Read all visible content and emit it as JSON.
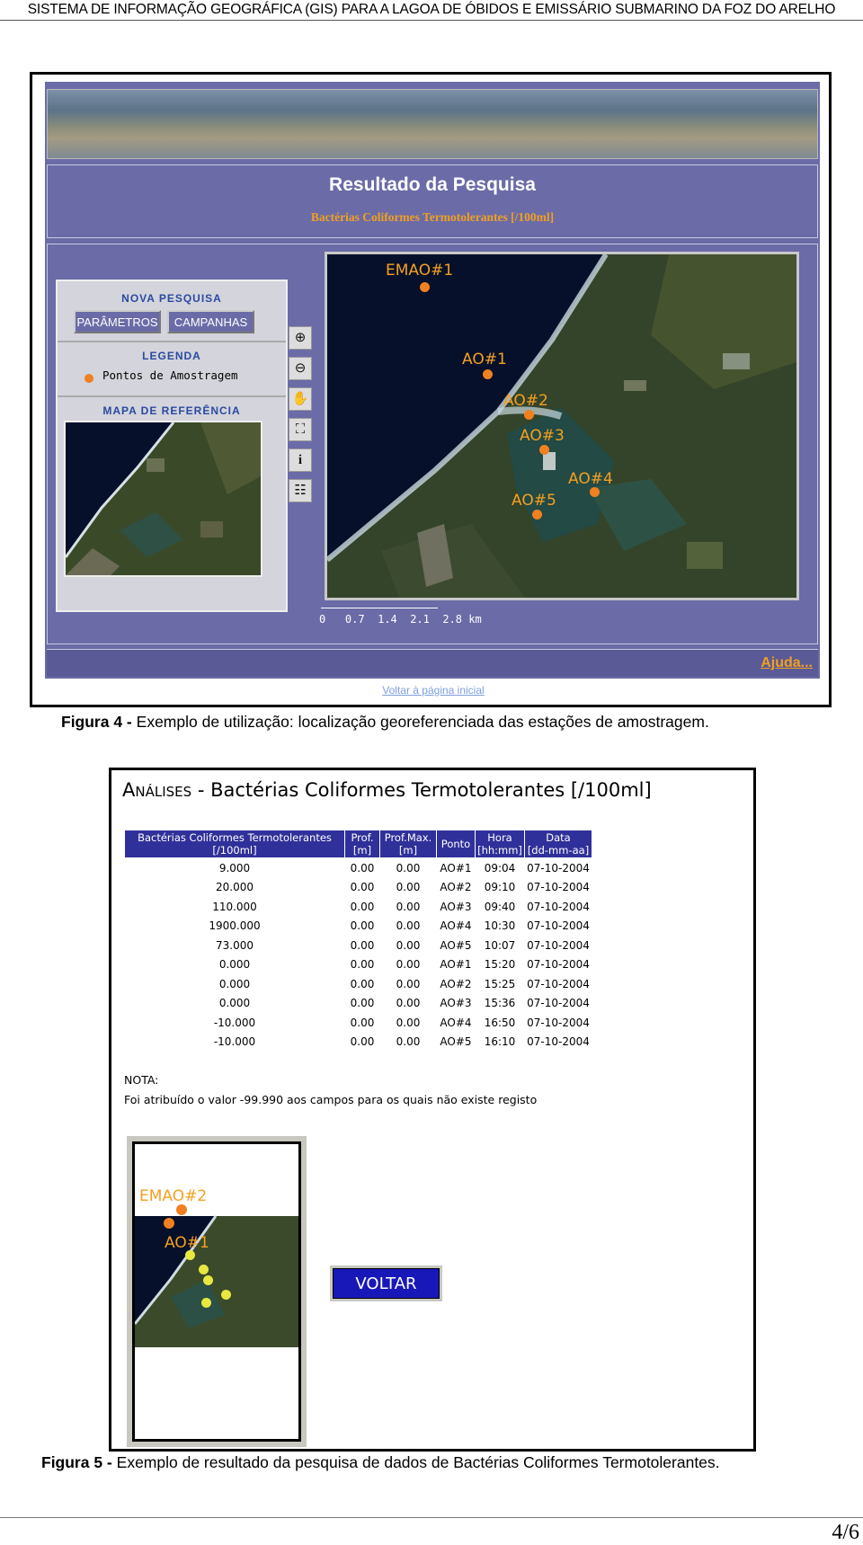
{
  "header": "SISTEMA DE INFORMAÇÃO GEOGRÁFICA (GIS) PARA A LAGOA DE ÓBIDOS E EMISSÁRIO SUBMARINO DA FOZ DO ARELHO",
  "fig4": {
    "result_title": "Resultado da Pesquisa",
    "result_subtitle": "Bactérias Coliformes Termotolerantes [/100ml]",
    "nova_pesquisa": "NOVA PESQUISA",
    "btn_parametros": "PARÂMETROS",
    "btn_campanhas": "CAMPANHAS",
    "legenda": "LEGENDA",
    "legend_item": "Pontos de Amostragem",
    "mapa_referencia": "MAPA DE REFERÊNCIA",
    "map_labels": [
      "EMAO#1",
      "AO#1",
      "AO#2",
      "AO#3",
      "AO#4",
      "AO#5"
    ],
    "scale_ticks": [
      "0",
      "0.7",
      "1.4",
      "2.1",
      "2.8"
    ],
    "scale_unit": "km",
    "ajuda": "Ajuda...",
    "voltar_link": "Voltar à página inicial",
    "caption_label": "Figura 4 -",
    "caption_text": "Exemplo de utilização: localização georeferenciada das estações de amostragem."
  },
  "fig5": {
    "title_a": "Análises",
    "title_b": " - Bactérias Coliformes Termotolerantes [/100ml]",
    "columns": [
      [
        "Bactérias Coliformes Termotolerantes",
        "[/100ml]"
      ],
      [
        "Prof.",
        "[m]"
      ],
      [
        "Prof.Max.",
        "[m]"
      ],
      [
        "Ponto",
        ""
      ],
      [
        "Hora",
        "[hh:mm]"
      ],
      [
        "Data",
        "[dd-mm-aa]"
      ]
    ],
    "rows": [
      [
        "9.000",
        "0.00",
        "0.00",
        "AO#1",
        "09:04",
        "07-10-2004"
      ],
      [
        "20.000",
        "0.00",
        "0.00",
        "AO#2",
        "09:10",
        "07-10-2004"
      ],
      [
        "110.000",
        "0.00",
        "0.00",
        "AO#3",
        "09:40",
        "07-10-2004"
      ],
      [
        "1900.000",
        "0.00",
        "0.00",
        "AO#4",
        "10:30",
        "07-10-2004"
      ],
      [
        "73.000",
        "0.00",
        "0.00",
        "AO#5",
        "10:07",
        "07-10-2004"
      ],
      [
        "0.000",
        "0.00",
        "0.00",
        "AO#1",
        "15:20",
        "07-10-2004"
      ],
      [
        "0.000",
        "0.00",
        "0.00",
        "AO#2",
        "15:25",
        "07-10-2004"
      ],
      [
        "0.000",
        "0.00",
        "0.00",
        "AO#3",
        "15:36",
        "07-10-2004"
      ],
      [
        "-10.000",
        "0.00",
        "0.00",
        "AO#4",
        "16:50",
        "07-10-2004"
      ],
      [
        "-10.000",
        "0.00",
        "0.00",
        "AO#5",
        "16:10",
        "07-10-2004"
      ]
    ],
    "nota_label": "NOTA:",
    "nota_text": "Foi atribuído o valor -99.990 aos campos para os quais não existe registo",
    "thumb_labels": [
      "EMAO#2",
      "AO#1"
    ],
    "voltar_btn": "VOLTAR",
    "caption_label": "Figura 5 -",
    "caption_text": "Exemplo de resultado da pesquisa de dados de Bactérias Coliformes Termotolerantes."
  },
  "page_number": "4/6",
  "colors": {
    "panel": "#6b6ba8",
    "accent": "#f0a020",
    "table_header": "#30309a",
    "button": "#1818b8"
  }
}
